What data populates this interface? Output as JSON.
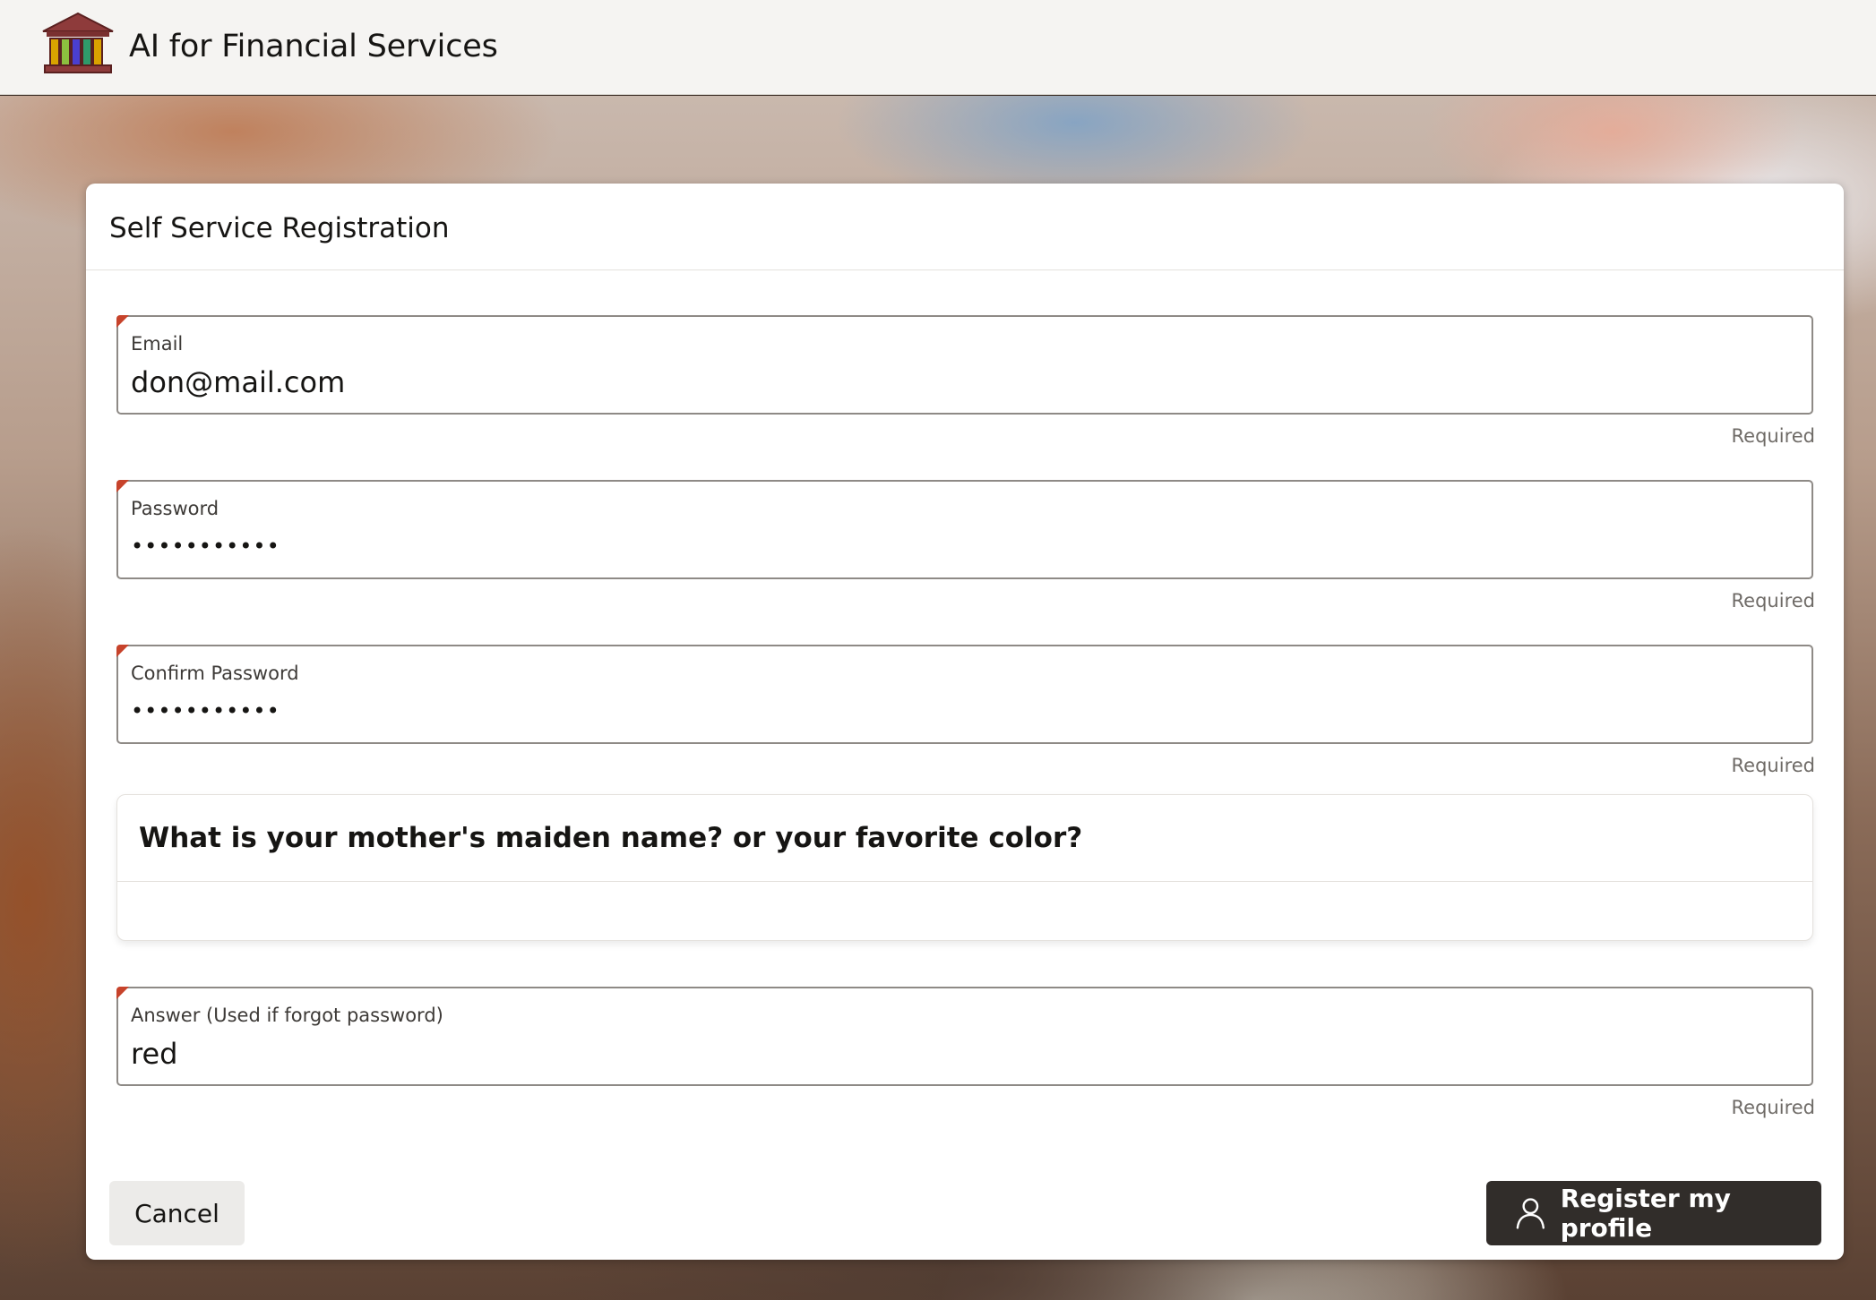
{
  "header": {
    "app_title": "AI for Financial Services",
    "logo_icon": "bank-building-icon"
  },
  "form": {
    "title": "Self Service Registration",
    "fields": [
      {
        "label": "Email",
        "value": "don@mail.com",
        "helper": "Required"
      },
      {
        "label": "Password",
        "value": "•••••••••••",
        "helper": "Required"
      },
      {
        "label": "Confirm Password",
        "value": "•••••••••••",
        "helper": "Required"
      },
      {
        "label": "Answer (Used if forgot password)",
        "value": "red",
        "helper": "Required"
      }
    ],
    "security_question": "What is your mother's maiden name? or your favorite color?",
    "required_indicator_color": "#c7432b"
  },
  "actions": {
    "cancel_label": "Cancel",
    "register_label": "Register my profile",
    "register_icon": "user-icon"
  }
}
